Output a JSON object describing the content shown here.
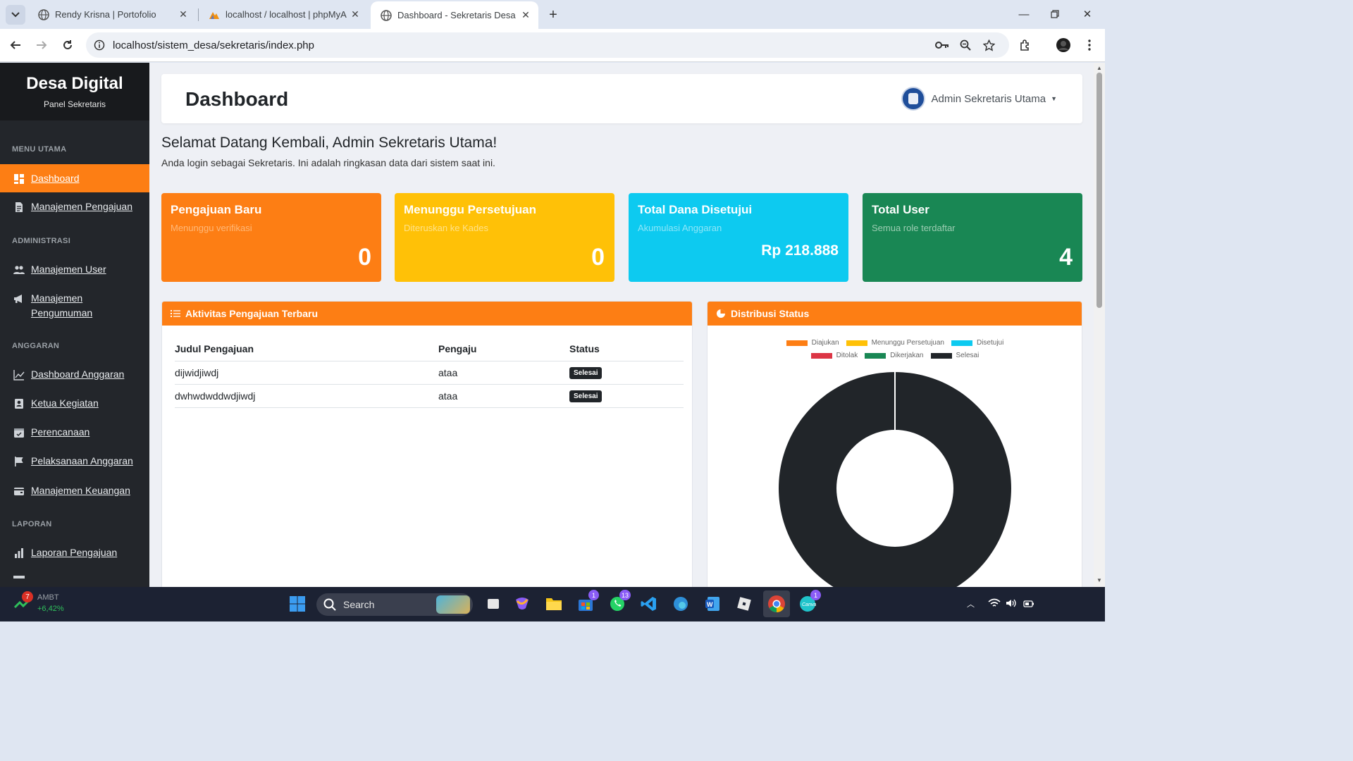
{
  "browser": {
    "tabs": [
      {
        "title": "Rendy Krisna | Portofolio",
        "active": false
      },
      {
        "title": "localhost / localhost | phpMyAd",
        "active": false
      },
      {
        "title": "Dashboard - Sekretaris Desa",
        "active": true
      }
    ],
    "url": "localhost/sistem_desa/sekretaris/index.php"
  },
  "sidebar": {
    "brand_title": "Desa Digital",
    "brand_sub": "Panel Sekretaris",
    "sections": [
      {
        "heading": "MENU UTAMA",
        "items": [
          {
            "label": "Dashboard",
            "icon": "dashboard-icon",
            "active": true
          },
          {
            "label": "Manajemen Pengajuan",
            "icon": "document-icon"
          }
        ]
      },
      {
        "heading": "ADMINISTRASI",
        "items": [
          {
            "label": "Manajemen User",
            "icon": "users-icon"
          },
          {
            "label": "Manajemen Pengumuman",
            "icon": "megaphone-icon"
          }
        ]
      },
      {
        "heading": "ANGGARAN",
        "items": [
          {
            "label": "Dashboard Anggaran",
            "icon": "line-chart-icon"
          },
          {
            "label": "Ketua Kegiatan",
            "icon": "id-badge-icon"
          },
          {
            "label": "Perencanaan",
            "icon": "calendar-icon"
          },
          {
            "label": "Pelaksanaan Anggaran",
            "icon": "flag-icon"
          },
          {
            "label": "Manajemen Keuangan",
            "icon": "wallet-icon"
          }
        ]
      },
      {
        "heading": "LAPORAN",
        "items": [
          {
            "label": "Laporan Pengajuan",
            "icon": "bar-chart-icon"
          }
        ]
      }
    ]
  },
  "header": {
    "title": "Dashboard",
    "user_name": "Admin Sekretaris Utama"
  },
  "welcome": {
    "title": "Selamat Datang Kembali, Admin Sekretaris Utama!",
    "subtitle": "Anda login sebagai Sekretaris. Ini adalah ringkasan data dari sistem saat ini."
  },
  "stats": [
    {
      "title": "Pengajuan Baru",
      "subtitle": "Menunggu verifikasi",
      "value": "0",
      "color": "#fd7e14"
    },
    {
      "title": "Menunggu Persetujuan",
      "subtitle": "Diteruskan ke Kades",
      "value": "0",
      "color": "#ffc107"
    },
    {
      "title": "Total Dana Disetujui",
      "subtitle": "Akumulasi Anggaran",
      "value": "Rp 218.888",
      "color": "#0dcaf0"
    },
    {
      "title": "Total User",
      "subtitle": "Semua role terdaftar",
      "value": "4",
      "color": "#198754"
    }
  ],
  "activity": {
    "heading": "Aktivitas Pengajuan Terbaru",
    "columns": [
      "Judul Pengajuan",
      "Pengaju",
      "Status"
    ],
    "rows": [
      {
        "judul": "dijwidjiwdj",
        "pengaju": "ataa",
        "status": "Selesai"
      },
      {
        "judul": "dwhwdwddwdjiwdj",
        "pengaju": "ataa",
        "status": "Selesai"
      }
    ]
  },
  "distribution": {
    "heading": "Distribusi Status"
  },
  "chart_data": {
    "type": "pie",
    "style": "doughnut",
    "categories": [
      "Diajukan",
      "Menunggu Persetujuan",
      "Disetujui",
      "Ditolak",
      "Dikerjakan",
      "Selesai"
    ],
    "values": [
      0,
      0,
      0,
      0,
      0,
      2
    ],
    "colors": [
      "#fd7e14",
      "#ffc107",
      "#0dcaf0",
      "#dc3545",
      "#198754",
      "#212529"
    ],
    "legend": "top"
  },
  "taskbar": {
    "weather_ticker": "AMBT",
    "weather_change": "+6,42%",
    "weather_badge": "7",
    "search_placeholder": "Search",
    "badges": {
      "store": "1",
      "whatsapp": "13",
      "canva": "1"
    }
  }
}
